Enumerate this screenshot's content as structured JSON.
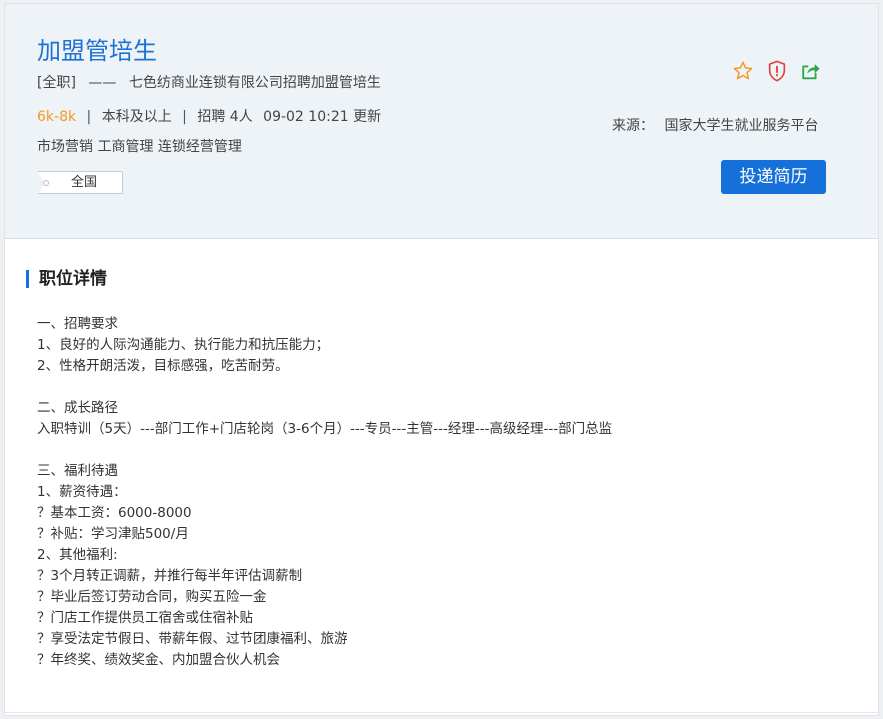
{
  "job": {
    "title": "加盟管培生",
    "type": "[全职]",
    "dash": "——",
    "company_line": "七色纺商业连锁有限公司招聘加盟管培生",
    "salary": "6k-8k",
    "separator": "|",
    "education": "本科及以上",
    "headcount": "招聘 4人",
    "updated": "09-02 10:21 更新",
    "categories": "市场营销 工商管理 连锁经营管理",
    "location": "全国"
  },
  "source": {
    "label": "来源：",
    "value": "国家大学生就业服务平台"
  },
  "actions": {
    "apply_label": "投递简历",
    "icons": [
      "star-icon",
      "shield-icon",
      "share-icon"
    ],
    "colors": {
      "star": "#f39a1e",
      "shield": "#e13d3d",
      "share": "#2aa84a",
      "accent": "#1670d9"
    }
  },
  "section": {
    "title": "职位详情"
  },
  "description": [
    "一、招聘要求",
    "1、良好的人际沟通能力、执行能力和抗压能力；",
    "2、性格开朗活泼，目标感强，吃苦耐劳。",
    "",
    "二、成长路径",
    "入职特训（5天）---部门工作+门店轮岗（3-6个月）---专员---主管---经理---高级经理---部门总监",
    "",
    "三、福利待遇",
    "1、薪资待遇：",
    "？基本工资：6000-8000",
    "？补贴：学习津贴500/月",
    "2、其他福利:",
    "？3个月转正调薪，并推行每半年评估调薪制",
    "？毕业后签订劳动合同，购买五险一金",
    "？门店工作提供员工宿舍或住宿补贴",
    "？享受法定节假日、带薪年假、过节团康福利、旅游",
    "？年终奖、绩效奖金、内加盟合伙人机会"
  ]
}
